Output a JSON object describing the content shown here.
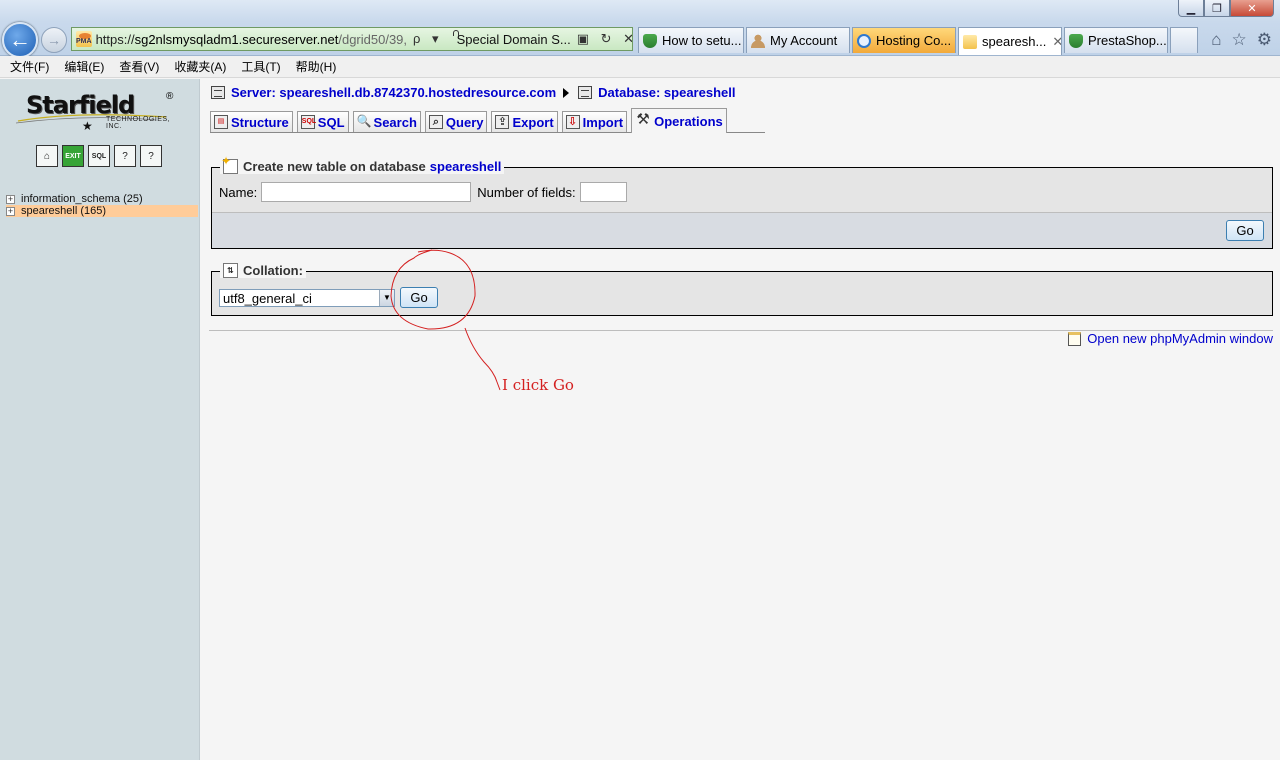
{
  "browser": {
    "url_prefix": "https://",
    "url_domain": "sg2nlsmysqladm1.secureserver.net",
    "url_path": "/dgrid50/39,",
    "cert_label": "Special Domain S...",
    "address_tools": "ρ ▾",
    "tabs": [
      {
        "label": "How to setu...",
        "icon": "site-icon"
      },
      {
        "label": "My Account",
        "icon": "person-icon"
      },
      {
        "label": "Hosting Co...",
        "icon": "ie-icon"
      },
      {
        "label": "spearesh...",
        "icon": "pma-icon",
        "close": "✕"
      },
      {
        "label": "PrestaShop...",
        "icon": "site-icon"
      }
    ],
    "window_controls": {
      "minimize": "▁",
      "maximize": "❐",
      "close": "✕"
    },
    "nav_icons": {
      "home": "⌂",
      "favorites": "☆",
      "settings": "⚙"
    },
    "menu": [
      "文件(F)",
      "编辑(E)",
      "查看(V)",
      "收藏夹(A)",
      "工具(T)",
      "帮助(H)"
    ]
  },
  "sidebar": {
    "logo_text": "Starfield",
    "logo_reg": "®",
    "logo_sub": "TECHNOLOGIES, INC.",
    "quick_icons": [
      {
        "name": "home",
        "glyph": "⌂"
      },
      {
        "name": "exit",
        "glyph": "EXIT"
      },
      {
        "name": "sql",
        "glyph": "SQL"
      },
      {
        "name": "docs",
        "glyph": "?"
      },
      {
        "name": "mysql-docs",
        "glyph": "?"
      }
    ],
    "databases": [
      {
        "name": "information_schema (25)",
        "selected": false
      },
      {
        "name": "speareshell (165)",
        "selected": true
      }
    ],
    "expander": "+"
  },
  "main": {
    "server_label": "Server: speareshell.db.8742370.hostedresource.com",
    "database_label": "Database: speareshell",
    "tabs": [
      {
        "label": "Structure",
        "icon": "structure-icon",
        "glyph": "▤"
      },
      {
        "label": "SQL",
        "icon": "sql-icon",
        "glyph": "SQL"
      },
      {
        "label": "Search",
        "icon": "search-icon",
        "glyph": "🔍"
      },
      {
        "label": "Query",
        "icon": "query-icon",
        "glyph": "⌕"
      },
      {
        "label": "Export",
        "icon": "export-icon",
        "glyph": "⇪"
      },
      {
        "label": "Import",
        "icon": "import-icon",
        "glyph": "⇩"
      },
      {
        "label": "Operations",
        "icon": "operations-icon",
        "glyph": "⚒",
        "active": true
      }
    ],
    "create_table": {
      "legend": "Create new table on database",
      "database": "speareshell",
      "name_label": "Name:",
      "name_value": "",
      "fields_label": "Number of fields:",
      "fields_value": "",
      "go_label": "Go"
    },
    "collation": {
      "legend": "Collation:",
      "legend_glyph": "⇅",
      "selected": "utf8_general_ci",
      "dropdown_glyph": "▼",
      "go_label": "Go"
    },
    "new_window_link": "Open new phpMyAdmin window"
  },
  "annotation": {
    "text": "I click Go",
    "color": "#d42020"
  }
}
